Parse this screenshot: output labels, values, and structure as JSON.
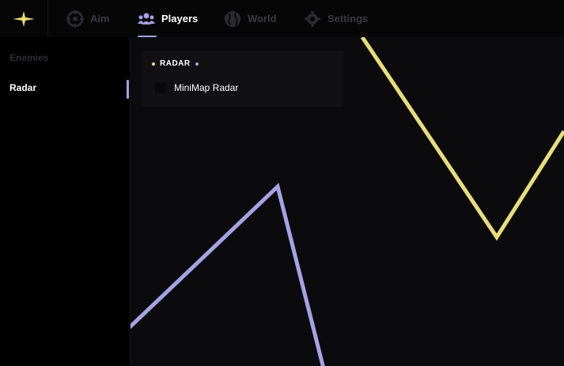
{
  "app": {
    "logo_icon": "sparkle-star-icon",
    "accent_color": "#a5a3e6",
    "logo_color": "#e9dd7a"
  },
  "tabs": [
    {
      "label": "Aim",
      "icon": "crosshair-icon",
      "active": false
    },
    {
      "label": "Players",
      "icon": "users-icon",
      "active": true
    },
    {
      "label": "World",
      "icon": "globe-icon",
      "active": false
    },
    {
      "label": "Settings",
      "icon": "gear-icon",
      "active": false
    }
  ],
  "sidebar": {
    "items": [
      {
        "label": "Enemies",
        "active": false
      },
      {
        "label": "Radar",
        "active": true
      }
    ]
  },
  "radar_panel": {
    "title": "RADAR",
    "options": [
      {
        "label": "MiniMap Radar",
        "checked": false
      }
    ]
  },
  "decoration": {
    "yellow_line_color": "#e9dd7a",
    "purple_line_color": "#a5a3e6"
  }
}
